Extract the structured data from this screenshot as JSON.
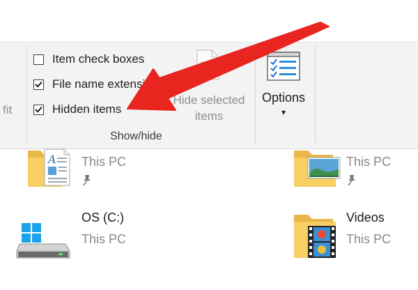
{
  "ribbon": {
    "left_partial_label": "fit",
    "show_hide": {
      "group_label": "Show/hide",
      "options": [
        {
          "label": "Item check boxes",
          "checked": false
        },
        {
          "label": "File name extensio",
          "checked": true
        },
        {
          "label": "Hidden items",
          "checked": true
        }
      ],
      "hide_selected_line1": "Hide selected",
      "hide_selected_line2": "items"
    },
    "options_button": {
      "label": "Options",
      "arrow": "▾"
    }
  },
  "annotation": {
    "color": "#e8251f"
  },
  "items": [
    {
      "name": "",
      "subtitle": "This PC",
      "icon": "documents-folder-icon",
      "pinned": true
    },
    {
      "name": "",
      "subtitle": "This PC",
      "icon": "pictures-folder-icon",
      "pinned": true
    },
    {
      "name": "OS (C:)",
      "subtitle": "This PC",
      "icon": "windows-drive-icon",
      "pinned": false
    },
    {
      "name": "Videos",
      "subtitle": "This PC",
      "icon": "videos-folder-icon",
      "pinned": false
    }
  ]
}
